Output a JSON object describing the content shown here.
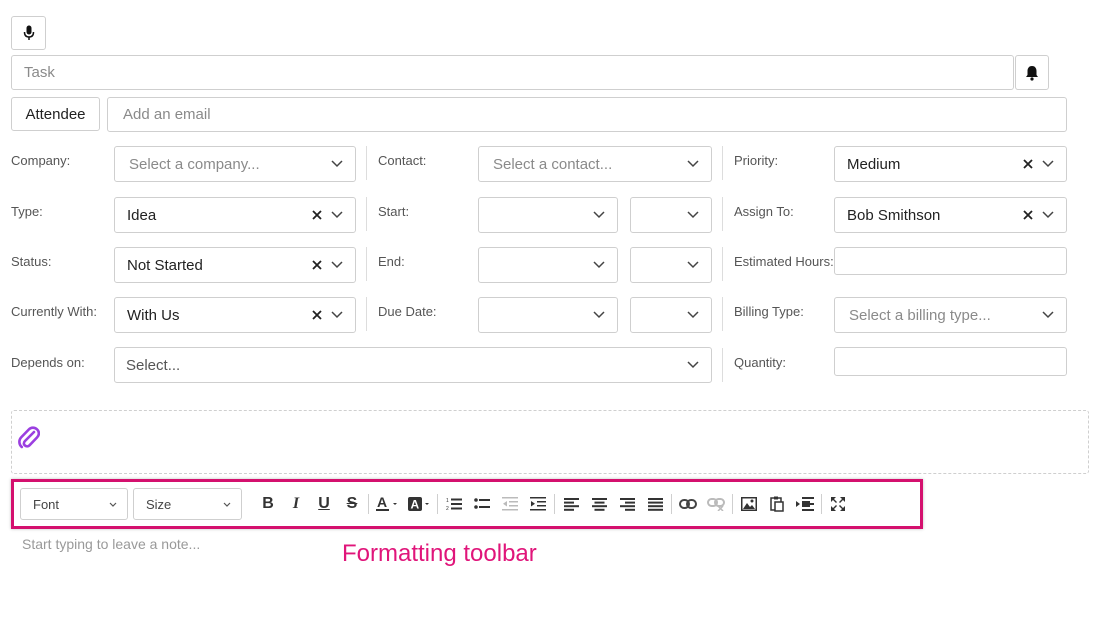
{
  "task": {
    "placeholder": "Task"
  },
  "attendee": {
    "button_label": "Attendee",
    "email_placeholder": "Add an email"
  },
  "form": {
    "company": {
      "label": "Company:",
      "placeholder": "Select a company..."
    },
    "contact": {
      "label": "Contact:",
      "placeholder": "Select a contact..."
    },
    "priority": {
      "label": "Priority:",
      "value": "Medium"
    },
    "type": {
      "label": "Type:",
      "value": "Idea"
    },
    "start": {
      "label": "Start:"
    },
    "assign_to": {
      "label": "Assign To:",
      "value": "Bob Smithson"
    },
    "status": {
      "label": "Status:",
      "value": "Not Started"
    },
    "end": {
      "label": "End:"
    },
    "estimated_hours": {
      "label": "Estimated Hours:"
    },
    "currently_with": {
      "label": "Currently With:",
      "value": "With Us"
    },
    "due_date": {
      "label": "Due Date:"
    },
    "billing_type": {
      "label": "Billing Type:",
      "placeholder": "Select a billing type..."
    },
    "depends_on": {
      "label": "Depends on:",
      "placeholder": "Select..."
    },
    "quantity": {
      "label": "Quantity:"
    }
  },
  "toolbar": {
    "font_label": "Font",
    "size_label": "Size",
    "buttons": [
      "bold-icon",
      "italic-icon",
      "underline-icon",
      "strikethrough-icon",
      "text-color-icon",
      "highlight-color-icon",
      "ordered-list-icon",
      "bullet-list-icon",
      "outdent-icon",
      "indent-icon",
      "align-left-icon",
      "align-center-icon",
      "align-right-icon",
      "justify-icon",
      "link-icon",
      "unlink-icon",
      "image-icon",
      "paste-icon",
      "indent-block-icon",
      "fullscreen-icon"
    ]
  },
  "note": {
    "placeholder": "Start typing to leave a note..."
  },
  "annotation": {
    "text": "Formatting toolbar",
    "color": "#e0157a"
  },
  "colors": {
    "accent_icon": "#9b3fe0",
    "highlight_border": "#d4106e"
  }
}
